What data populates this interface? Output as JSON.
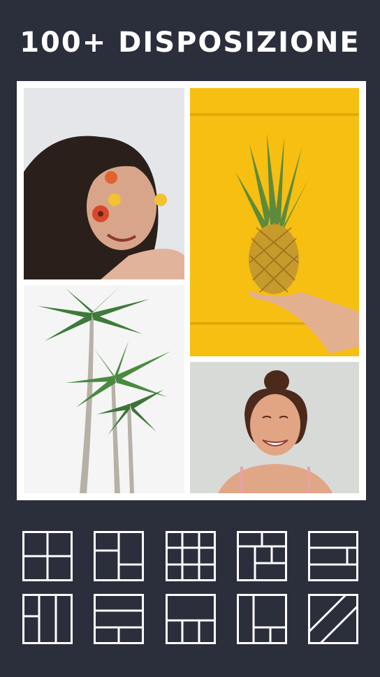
{
  "headline": "100+ DISPOSIZIONE",
  "colors": {
    "background": "#2b2e3b",
    "collage_frame": "#ffffff",
    "accent_yellow": "#f6bf12"
  },
  "collage": {
    "photos": [
      {
        "name": "photo-woman-with-flowers",
        "alt": "woman with flowers in hair"
      },
      {
        "name": "photo-pineapple",
        "alt": "hand holding pineapple on yellow background"
      },
      {
        "name": "photo-palm-trees",
        "alt": "palm trees against white sky"
      },
      {
        "name": "photo-smiling-woman",
        "alt": "smiling woman lying on sand"
      }
    ]
  },
  "layout_options": [
    "grid-2x2-layout-icon",
    "split-right-layout-icon",
    "grid-3x3-layout-icon",
    "mixed-grid-layout-icon",
    "rows-layout-icon",
    "columns-layout-icon",
    "stacked-rows-layout-icon",
    "bottom-split-layout-icon",
    "l-shape-layout-icon",
    "diagonal-layout-icon"
  ]
}
